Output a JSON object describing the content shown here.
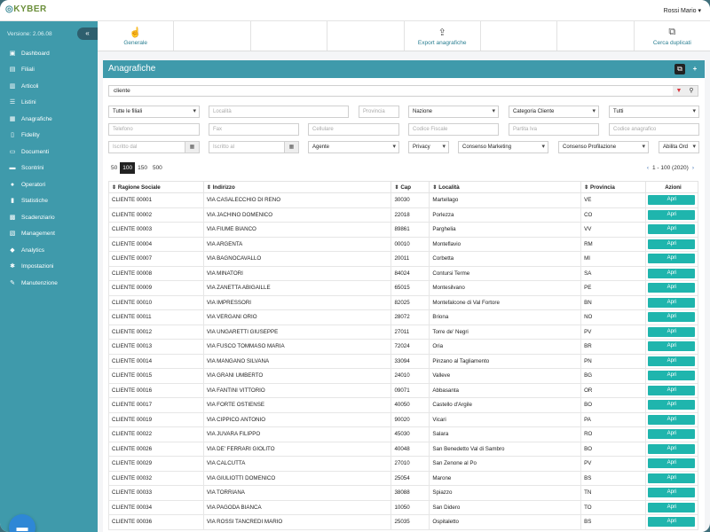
{
  "header": {
    "logo": "KYBER",
    "user": "Rossi Mario ▾"
  },
  "sidebar": {
    "version": "Versione: 2.06.08",
    "collapse_icon": "«",
    "items": [
      {
        "label": "Dashboard",
        "icon": "▣"
      },
      {
        "label": "Filiali",
        "icon": "▤"
      },
      {
        "label": "Articoli",
        "icon": "▥"
      },
      {
        "label": "Listini",
        "icon": "☰"
      },
      {
        "label": "Anagrafiche",
        "icon": "▦"
      },
      {
        "label": "Fidelity",
        "icon": "▯"
      },
      {
        "label": "Documenti",
        "icon": "▭"
      },
      {
        "label": "Scontrini",
        "icon": "▬"
      },
      {
        "label": "Operatori",
        "icon": "●"
      },
      {
        "label": "Statistiche",
        "icon": "▮"
      },
      {
        "label": "Scadenziario",
        "icon": "▩"
      },
      {
        "label": "Management",
        "icon": "▧"
      },
      {
        "label": "Analytics",
        "icon": "◆"
      },
      {
        "label": "Impostazioni",
        "icon": "✱"
      },
      {
        "label": "Manutenzione",
        "icon": "✎"
      }
    ]
  },
  "toolbar": {
    "buttons": [
      {
        "label": "Generale",
        "icon": "☝"
      },
      {
        "label": "",
        "icon": ""
      },
      {
        "label": "",
        "icon": ""
      },
      {
        "label": "",
        "icon": ""
      },
      {
        "label": "Export anagrafiche",
        "icon": "⇪"
      },
      {
        "label": "",
        "icon": ""
      },
      {
        "label": "",
        "icon": ""
      },
      {
        "label": "Cerca duplicati",
        "icon": "⧉"
      }
    ]
  },
  "panel": {
    "title": "Anagrafiche",
    "search_value": "cliente"
  },
  "filters": {
    "filiali": "Tutte le filiali",
    "localita": "Località",
    "provincia": "Provincia",
    "nazione": "Nazione",
    "categoria": "Categoria Cliente",
    "tutti": "Tutti",
    "telefono": "Telefono",
    "fax": "Fax",
    "cellulare": "Cellulare",
    "codice_fiscale": "Codice Fiscale",
    "partita_iva": "Partita Iva",
    "codice_anagrafico": "Codice anagrafico",
    "iscritto_dal": "Iscritto dal",
    "iscritto_al": "Iscritto al",
    "agente": "Agente",
    "privacy": "Privacy",
    "consenso_marketing": "Consenso Marketing",
    "consenso_profilazione": "Consenso Profilazione",
    "abilita_ord": "Abilita Ord"
  },
  "pager": {
    "sizes": [
      "50",
      "100",
      "150",
      "500"
    ],
    "active": "100",
    "info": "1 - 100 (2020)",
    "prev": "‹",
    "next": "›"
  },
  "table": {
    "headers": [
      "⇕ Ragione Sociale",
      "⇕ Indirizzo",
      "⇕ Cap",
      "⇕ Località",
      "⇕ Provincia",
      "Azioni"
    ],
    "action_label": "Apri",
    "rows": [
      [
        "CLIENTE 00001",
        "VIA CASALECCHIO DI RENO",
        "30030",
        "Martellago",
        "VE"
      ],
      [
        "CLIENTE 00002",
        "VIA JACHINO DOMENICO",
        "22018",
        "Porlezza",
        "CO"
      ],
      [
        "CLIENTE 00003",
        "VIA FIUME BIANCO",
        "89861",
        "Parghelia",
        "VV"
      ],
      [
        "CLIENTE 00004",
        "VIA ARGENTA",
        "00010",
        "Monteflavio",
        "RM"
      ],
      [
        "CLIENTE 00007",
        "VIA BAGNOCAVALLO",
        "20011",
        "Corbetta",
        "MI"
      ],
      [
        "CLIENTE 00008",
        "VIA MINATORI",
        "84024",
        "Contursi Terme",
        "SA"
      ],
      [
        "CLIENTE 00009",
        "VIA ZANETTA ABIGAILLE",
        "65015",
        "Montesilvano",
        "PE"
      ],
      [
        "CLIENTE 00010",
        "VIA IMPRESSORI",
        "82025",
        "Montefalcone di Val Fortore",
        "BN"
      ],
      [
        "CLIENTE 00011",
        "VIA VERGANI ORIO",
        "28072",
        "Briona",
        "NO"
      ],
      [
        "CLIENTE 00012",
        "VIA UNGARETTI GIUSEPPE",
        "27011",
        "Torre de' Negri",
        "PV"
      ],
      [
        "CLIENTE 00013",
        "VIA FUSCO TOMMASO MARIA",
        "72024",
        "Oria",
        "BR"
      ],
      [
        "CLIENTE 00014",
        "VIA MANGANO SILVANA",
        "33094",
        "Pinzano al Tagliamento",
        "PN"
      ],
      [
        "CLIENTE 00015",
        "VIA GRANI UMBERTO",
        "24010",
        "Valleve",
        "BG"
      ],
      [
        "CLIENTE 00016",
        "VIA FANTINI VITTORIO",
        "09071",
        "Abbasanta",
        "OR"
      ],
      [
        "CLIENTE 00017",
        "VIA FORTE OSTIENSE",
        "40050",
        "Castello d'Argile",
        "BO"
      ],
      [
        "CLIENTE 00019",
        "VIA CIPPICO ANTONIO",
        "90020",
        "Vicari",
        "PA"
      ],
      [
        "CLIENTE 00022",
        "VIA JUVARA FILIPPO",
        "45030",
        "Salara",
        "RO"
      ],
      [
        "CLIENTE 00026",
        "VIA DE' FERRARI GIOLITO",
        "40048",
        "San Benedetto Val di Sambro",
        "BO"
      ],
      [
        "CLIENTE 00029",
        "VIA CALCUTTA",
        "27010",
        "San Zenone al Po",
        "PV"
      ],
      [
        "CLIENTE 00032",
        "VIA GIULIOTTI DOMENICO",
        "25054",
        "Marone",
        "BS"
      ],
      [
        "CLIENTE 00033",
        "VIA TORRIANA",
        "38088",
        "Spiazzo",
        "TN"
      ],
      [
        "CLIENTE 00034",
        "VIA PAGODA BIANCA",
        "10050",
        "San Didero",
        "TO"
      ],
      [
        "CLIENTE 00036",
        "VIA ROSSI TANCREDI MARIO",
        "25035",
        "Ospitaletto",
        "BS"
      ]
    ]
  }
}
